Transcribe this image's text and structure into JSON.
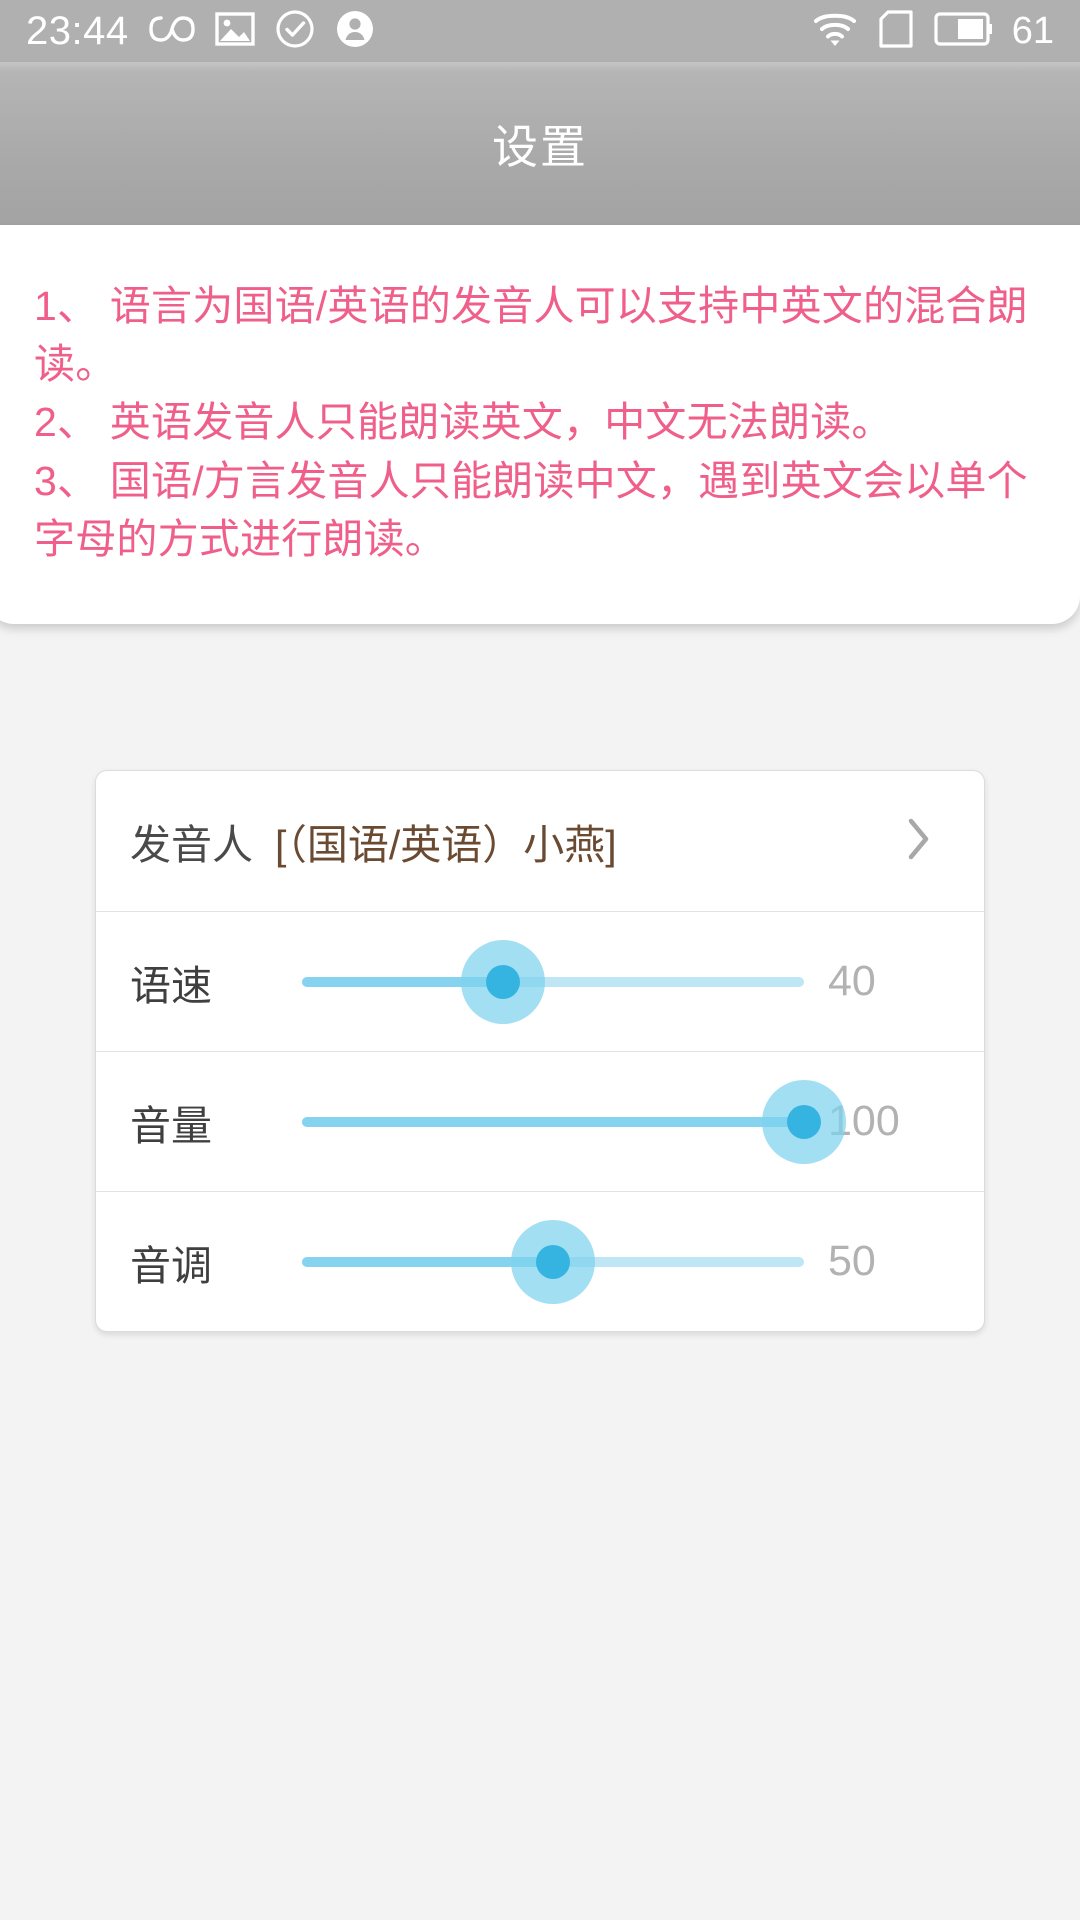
{
  "statusbar": {
    "time": "23:44",
    "battery_percent": "61",
    "left_icons": [
      "infinity-icon",
      "photo-icon",
      "check-circle-icon",
      "account-circle-icon"
    ],
    "right_icons": [
      "wifi-icon",
      "sim-card-icon",
      "battery-icon"
    ]
  },
  "header": {
    "title": "设置"
  },
  "notice": {
    "lines": [
      "1、 语言为国语/英语的发音人可以支持中英文的混合朗读。",
      "2、 英语发音人只能朗读英文，中文无法朗读。",
      "3、 国语/方言发音人只能朗读中文，遇到英文会以单个字母的方式进行朗读。"
    ],
    "text_color": "#ef5f8a"
  },
  "settings": {
    "voice_row": {
      "label": "发音人",
      "value": "[（国语/英语）小燕]",
      "chevron": "chevron-right-icon"
    },
    "sliders": [
      {
        "label": "语速",
        "value": "40",
        "percent": 40,
        "min": 0,
        "max": 100
      },
      {
        "label": "音量",
        "value": "100",
        "percent": 100,
        "min": 0,
        "max": 100
      },
      {
        "label": "音调",
        "value": "50",
        "percent": 50,
        "min": 0,
        "max": 100
      }
    ],
    "accent_color": "#35b4e2",
    "track_color": "#bfe6f5"
  }
}
